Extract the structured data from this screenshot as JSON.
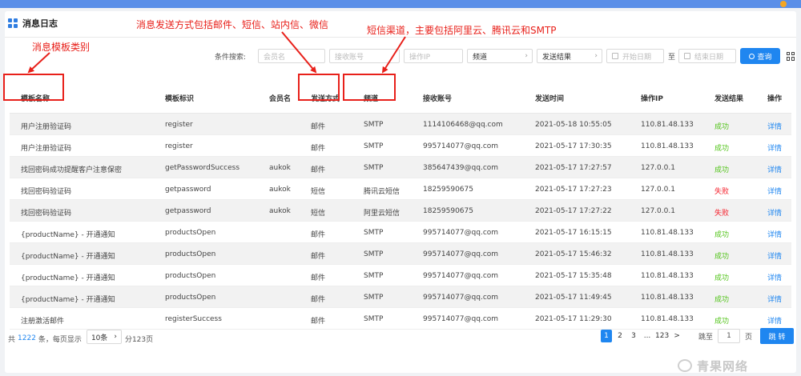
{
  "page": {
    "title": "消息日志"
  },
  "annotations": {
    "template_category": "消息模板类别",
    "send_methods": "消息发送方式包括邮件、短信、站内信、微信",
    "channels": "短信渠道，主要包括阿里云、腾讯云和SMTP"
  },
  "search": {
    "label": "条件搜索:",
    "member_placeholder": "会员名",
    "account_placeholder": "接收账号",
    "ip_placeholder": "操作IP",
    "channel_select": "频道",
    "result_select": "发送结果",
    "start_date": "开始日期",
    "to": "至",
    "end_date": "结束日期",
    "query_button": "查询"
  },
  "table": {
    "headers": [
      "模板名称",
      "模板标识",
      "会员名",
      "发送方式",
      "频道",
      "接收账号",
      "发送时间",
      "操作IP",
      "发送结果",
      "操作"
    ],
    "rows": [
      [
        "用户注册验证码",
        "register",
        "",
        "邮件",
        "SMTP",
        "1114106468@qq.com",
        "2021-05-18 10:55:05",
        "110.81.48.133",
        "成功",
        "详情"
      ],
      [
        "用户注册验证码",
        "register",
        "",
        "邮件",
        "SMTP",
        "995714077@qq.com",
        "2021-05-17 17:30:35",
        "110.81.48.133",
        "成功",
        "详情"
      ],
      [
        "找回密码成功提醒客户注意保密",
        "getPasswordSuccess",
        "aukok",
        "邮件",
        "SMTP",
        "385647439@qq.com",
        "2021-05-17 17:27:57",
        "127.0.0.1",
        "成功",
        "详情"
      ],
      [
        "找回密码验证码",
        "getpassword",
        "aukok",
        "短信",
        "腾讯云短信",
        "18259590675",
        "2021-05-17 17:27:23",
        "127.0.0.1",
        "失败",
        "详情"
      ],
      [
        "找回密码验证码",
        "getpassword",
        "aukok",
        "短信",
        "阿里云短信",
        "18259590675",
        "2021-05-17 17:27:22",
        "127.0.0.1",
        "失败",
        "详情"
      ],
      [
        "{productName} - 开通通知",
        "productsOpen",
        "",
        "邮件",
        "SMTP",
        "995714077@qq.com",
        "2021-05-17 16:15:15",
        "110.81.48.133",
        "成功",
        "详情"
      ],
      [
        "{productName} - 开通通知",
        "productsOpen",
        "",
        "邮件",
        "SMTP",
        "995714077@qq.com",
        "2021-05-17 15:46:32",
        "110.81.48.133",
        "成功",
        "详情"
      ],
      [
        "{productName} - 开通通知",
        "productsOpen",
        "",
        "邮件",
        "SMTP",
        "995714077@qq.com",
        "2021-05-17 15:35:48",
        "110.81.48.133",
        "成功",
        "详情"
      ],
      [
        "{productName} - 开通通知",
        "productsOpen",
        "",
        "邮件",
        "SMTP",
        "995714077@qq.com",
        "2021-05-17 11:49:45",
        "110.81.48.133",
        "成功",
        "详情"
      ],
      [
        "注册激活邮件",
        "registerSuccess",
        "",
        "邮件",
        "SMTP",
        "995714077@qq.com",
        "2021-05-17 11:29:30",
        "110.81.48.133",
        "成功",
        "详情"
      ]
    ]
  },
  "pagination": {
    "total_prefix": "共",
    "total": "1222",
    "total_suffix": "条，每页显示",
    "page_size": "10条",
    "pages_suffix": "分123页",
    "pages": [
      "1",
      "2",
      "3",
      "...",
      "123",
      ">"
    ],
    "current": "1",
    "jump_label": "跳至",
    "jump_value": "1",
    "page_unit": "页",
    "go_button": "跳 转"
  },
  "watermark": {
    "text": "青果网络"
  },
  "colors": {
    "accent": "#1f86f0",
    "success": "#52c41a",
    "fail": "#f5222d",
    "annotation": "#e8201a"
  }
}
